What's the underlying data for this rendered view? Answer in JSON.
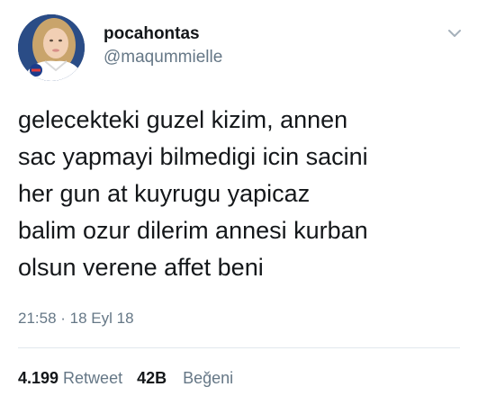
{
  "tweet": {
    "display_name": "pocahontas",
    "handle": "@maqummielle",
    "text_lines": [
      "gelecekteki guzel kizim, annen",
      "sac yapmayi bilmedigi icin sacini",
      "her gun at kuyrugu yapicaz",
      "balim ozur dilerim annesi kurban",
      "olsun verene affet beni"
    ],
    "timestamp": "21:58 · 18 Eyl 18",
    "retweet_count": "4.199",
    "retweet_label": "Retweet",
    "like_count": "42B",
    "like_label": "Beğeni"
  },
  "icons": {
    "menu": "chevron-down-icon",
    "avatar": "profile-photo"
  },
  "colors": {
    "text_primary": "#14171a",
    "text_secondary": "#657786",
    "divider": "#e1e8ed"
  }
}
